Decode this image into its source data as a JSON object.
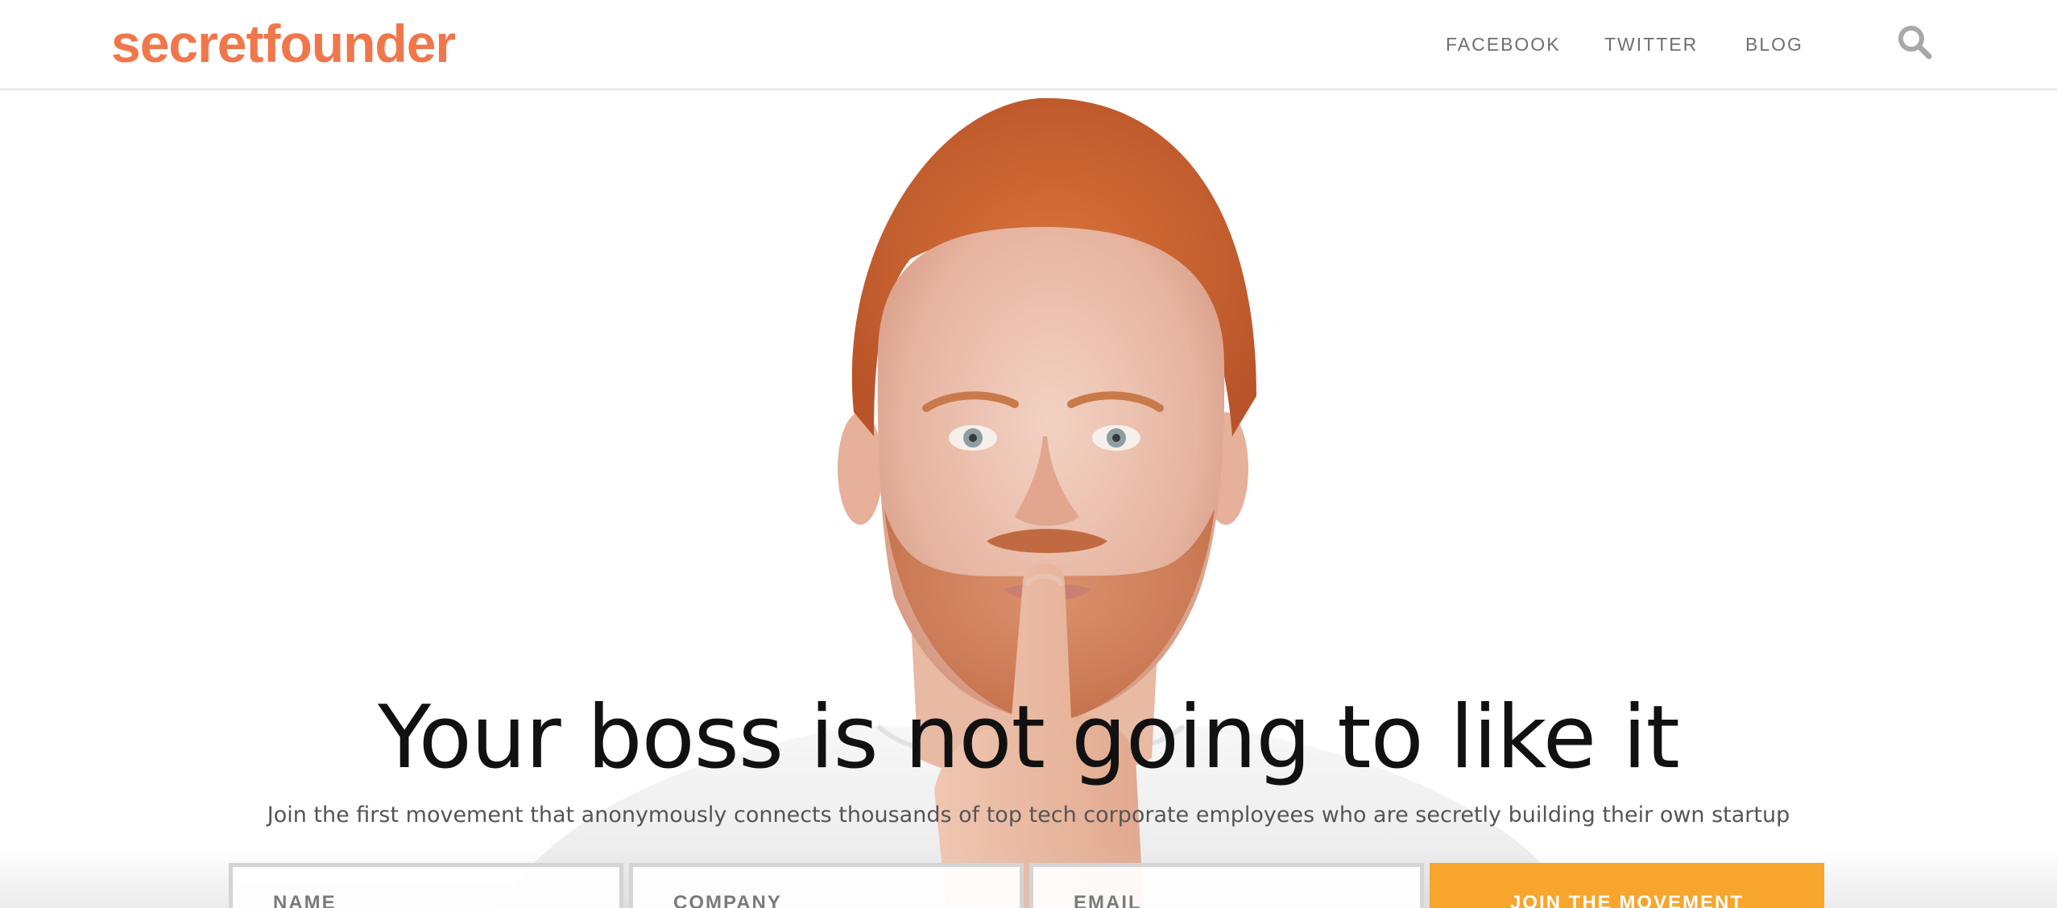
{
  "brand": {
    "logo_text": "secretfounder",
    "logo_color": "#f0774b",
    "accent_color": "#f7a52c"
  },
  "nav": {
    "items": [
      {
        "label": "FACEBOOK"
      },
      {
        "label": "TWITTER"
      },
      {
        "label": "BLOG"
      }
    ],
    "search_icon": "search-icon"
  },
  "hero": {
    "background_image": "man-with-finger-on-lips-shushing",
    "headline": "Your boss is not going to like it",
    "subline": "Join the first movement that anonymously connects thousands of top tech corporate employees who are secretly building their own startup"
  },
  "signup_form": {
    "name_placeholder": "NAME",
    "company_placeholder": "COMPANY",
    "email_placeholder": "EMAIL",
    "submit_label": "JOIN THE MOVEMENT"
  }
}
